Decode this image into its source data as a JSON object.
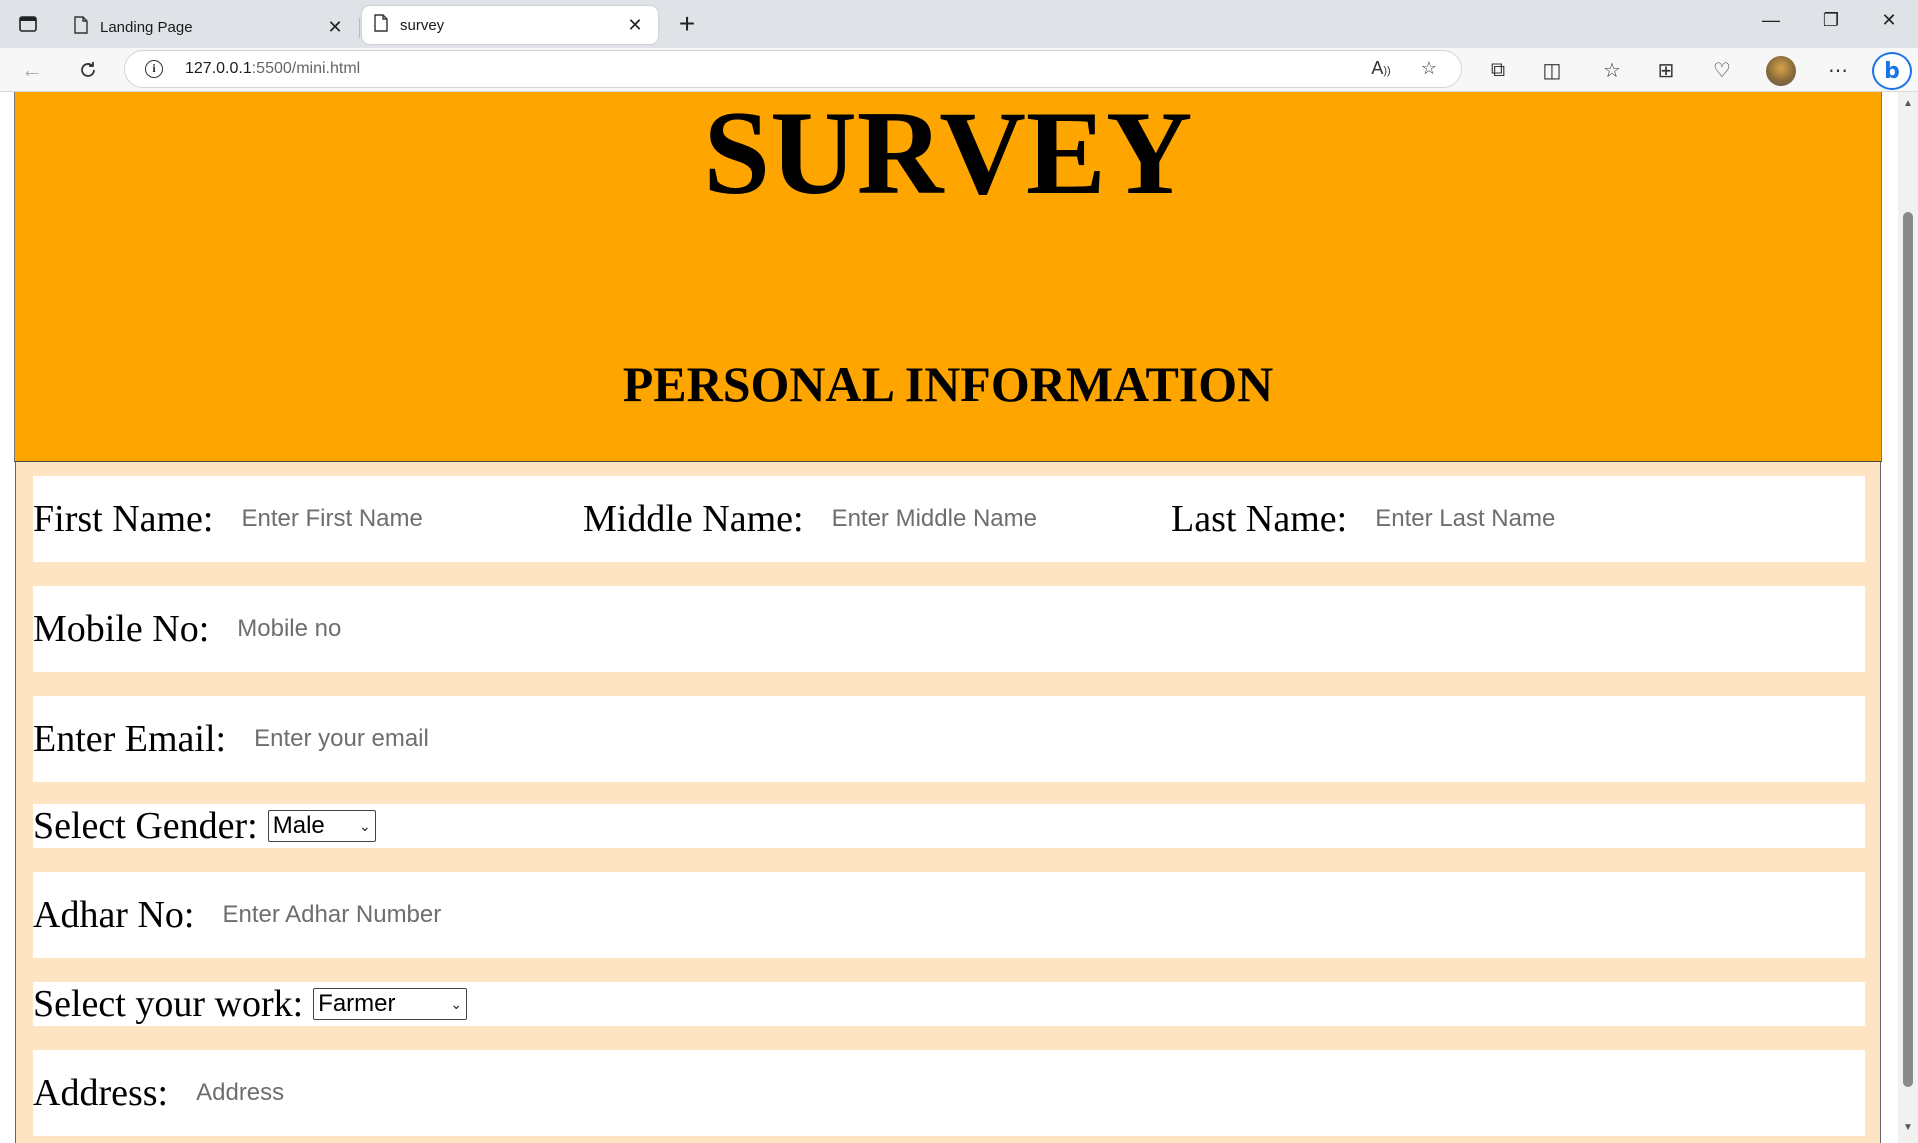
{
  "browser": {
    "tabs": [
      {
        "title": "Landing Page",
        "active": false
      },
      {
        "title": "survey",
        "active": true
      }
    ],
    "url_host": "127.0.0.1",
    "url_rest": ":5500/mini.html",
    "window_controls": {
      "minimize": "—",
      "restore": "❐",
      "close": "✕"
    }
  },
  "header": {
    "title": "SURVEY",
    "subtitle": "PERSONAL INFORMATION",
    "background_color": "#ffa500"
  },
  "form": {
    "background_color": "#ffe4c4",
    "first_name": {
      "label": "First Name:",
      "placeholder": "Enter First Name"
    },
    "middle_name": {
      "label": "Middle Name:",
      "placeholder": "Enter Middle Name"
    },
    "last_name": {
      "label": "Last Name:",
      "placeholder": "Enter Last Name"
    },
    "mobile": {
      "label": "Mobile No:",
      "placeholder": "Mobile no"
    },
    "email": {
      "label": "Enter Email:",
      "placeholder": "Enter your email"
    },
    "gender": {
      "label": "Select Gender:",
      "selected": "Male"
    },
    "adhar": {
      "label": "Adhar No:",
      "placeholder": "Enter Adhar Number"
    },
    "work": {
      "label": "Select your work:",
      "selected": "Farmer"
    },
    "address": {
      "label": "Address:",
      "placeholder": "Address"
    }
  }
}
